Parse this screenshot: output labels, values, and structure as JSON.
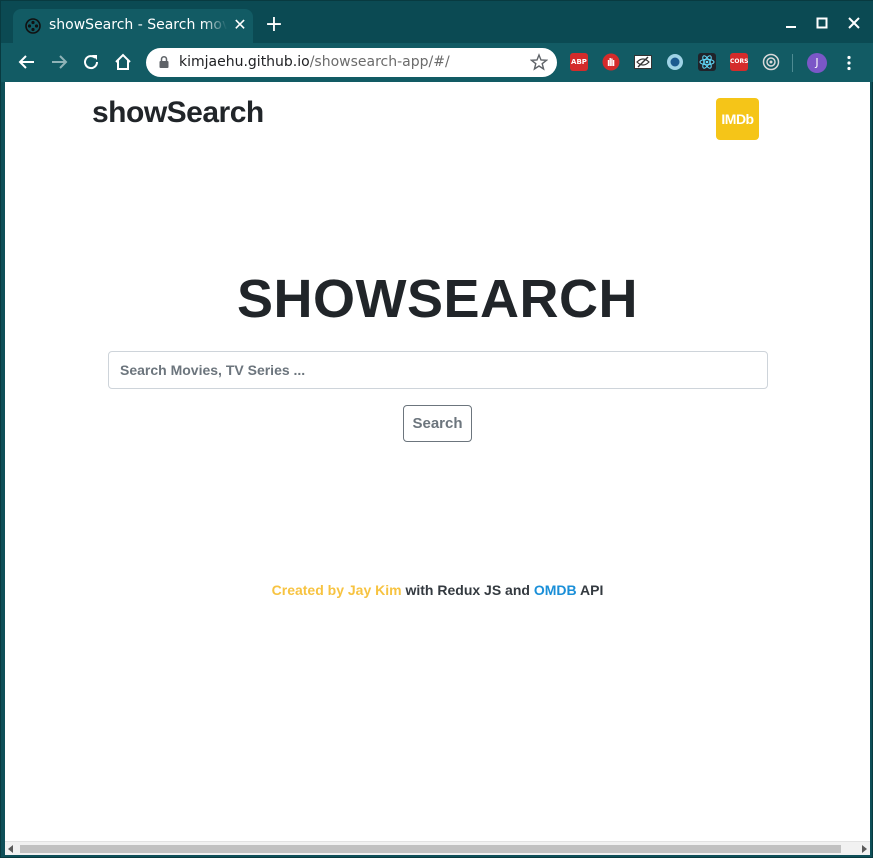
{
  "browser": {
    "tab": {
      "title": "showSearch - Search movies and TV series",
      "close_glyph": "✕",
      "favicon": "film-reel-icon"
    },
    "new_tab_glyph": "+",
    "address_bar": {
      "host": "kimjaehu.github.io",
      "path": "/showsearch-app/#/"
    },
    "extensions": [
      {
        "name": "adblock-plus-icon",
        "label": "ABP",
        "color": "#d42b2b"
      },
      {
        "name": "ublock-hand-icon",
        "label": "",
        "color": "#d42b2b"
      },
      {
        "name": "eye-slash-icon",
        "label": "",
        "color": "#ffffff"
      },
      {
        "name": "circle-extension-icon",
        "label": "",
        "color": "#9fd3e6"
      },
      {
        "name": "react-devtools-icon",
        "label": "",
        "color": "#61dafb"
      },
      {
        "name": "cors-icon",
        "label": "CORS",
        "color": "#d42b2b"
      },
      {
        "name": "target-extension-icon",
        "label": "",
        "color": "#d9d9d9"
      }
    ],
    "profile_initial": "J",
    "colors": {
      "frame": "#0b4a53",
      "toolbar": "#125b64"
    }
  },
  "page": {
    "brand": "showSearch",
    "imdb_badge": "IMDb",
    "hero_title": "SHOWSEARCH",
    "search": {
      "placeholder": "Search Movies, TV Series ...",
      "value": ""
    },
    "search_button": "Search",
    "footer": {
      "credit": "Created by Jay Kim",
      "middle": " with Redux JS and ",
      "omdb": "OMDB",
      "end": " API"
    },
    "colors": {
      "accent": "#f5c518",
      "link": "#1a8fd8",
      "text": "#212529"
    }
  }
}
